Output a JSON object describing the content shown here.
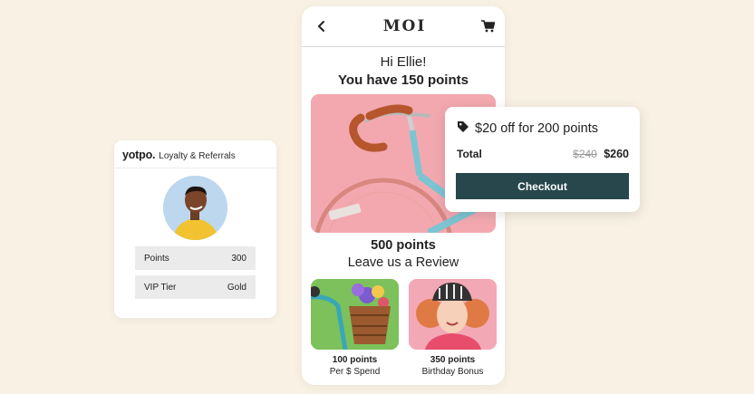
{
  "yotpo": {
    "logo": "yotpo.",
    "subtitle": "Loyalty & Referrals",
    "rows": [
      {
        "label": "Points",
        "value": "300"
      },
      {
        "label": "VIP Tier",
        "value": "Gold"
      }
    ]
  },
  "phone": {
    "brand": "MOI",
    "back_icon": "chevron-left",
    "cart_icon": "shopping-cart",
    "greeting": "Hi Ellie!",
    "points_line": "You have 150 points",
    "reward_points": "500 points",
    "reward_text": "Leave us a Review",
    "tiles": [
      {
        "points": "100 points",
        "label": "Per $ Spend"
      },
      {
        "points": "350 points",
        "label": "Birthday Bonus"
      }
    ]
  },
  "offer": {
    "icon": "tag",
    "title": "$20 off for 200 points",
    "total_label": "Total",
    "old_price": "$240",
    "new_price": "$260",
    "checkout_label": "Checkout"
  },
  "colors": {
    "background": "#f8f1e4",
    "checkout": "#27474c",
    "hero_pink": "#f3a8b0",
    "tile_green": "#7cc15b"
  }
}
